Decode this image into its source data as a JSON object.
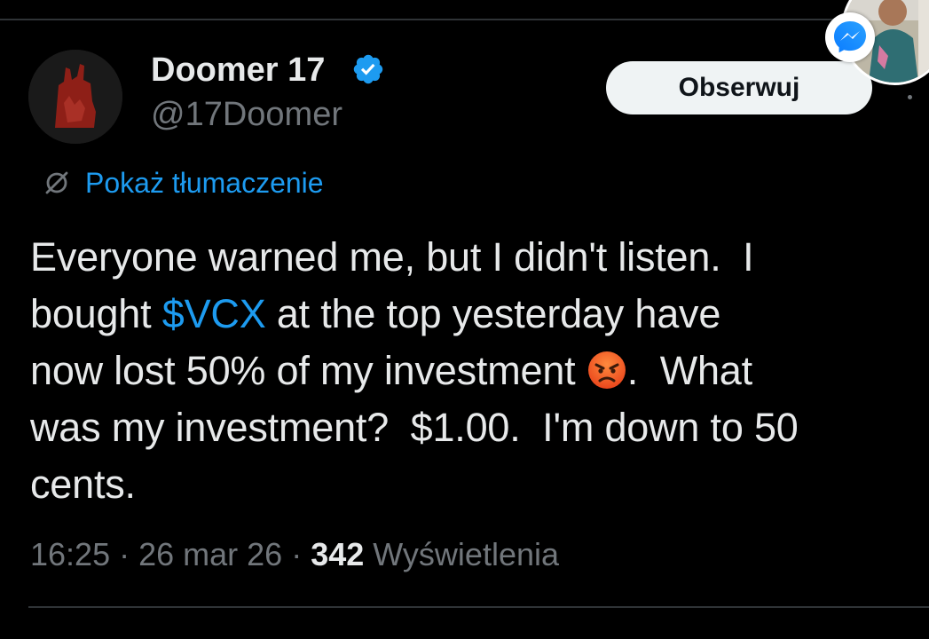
{
  "author": {
    "display_name": "Doomer 17",
    "handle": "@17Doomer",
    "verified": true
  },
  "follow_button": {
    "label": "Obserwuj"
  },
  "translate": {
    "label": "Pokaż tłumaczenie"
  },
  "tweet": {
    "text_part1": "Everyone warned me, but I didn't listen.  I\nbought ",
    "cashtag": "$VCX",
    "text_part2": " at the top yesterday have\nnow lost 50% of my investment ",
    "text_part3": ".  What\nwas my investment?  $1.00.  I'm down to 50\ncents.",
    "emoji": "angry-face-emoji"
  },
  "meta": {
    "time": "16:25",
    "separator1": " · ",
    "date": "26 mar 26",
    "separator2": " · ",
    "views_count": "342",
    "views_label": " Wyświetlenia"
  },
  "icons": {
    "verified": "verified-badge-icon",
    "translate": "translate-globe-icon",
    "messenger": "messenger-icon"
  },
  "colors": {
    "background": "#000000",
    "text": "#e7e9ea",
    "muted": "#71767b",
    "accent": "#1d9bf0",
    "button_bg": "#eff3f4",
    "button_text": "#0f1419"
  }
}
